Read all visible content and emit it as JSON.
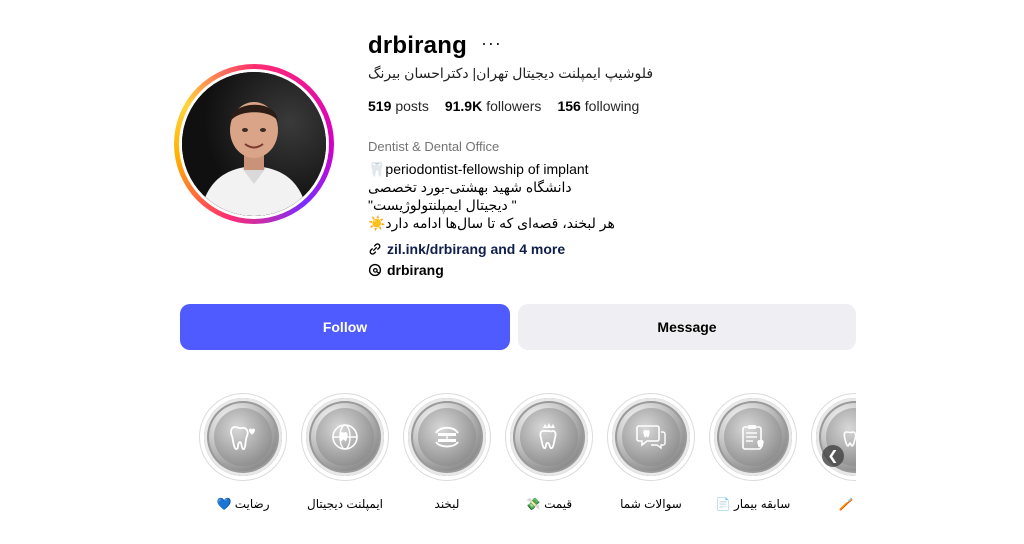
{
  "profile": {
    "username": "drbirang",
    "more_label": "···",
    "full_name": "فلوشیپ ایمپلنت دیجیتال تهران| دکتراحسان بیرنگ",
    "stats": {
      "posts_count": "519",
      "posts_label": "posts",
      "followers_count": "91.9K",
      "followers_label": "followers",
      "following_count": "156",
      "following_label": "following"
    },
    "category": "Dentist & Dental Office",
    "bio": {
      "line1": "🦷periodontist-fellowship of implant",
      "line2": "دانشگاه شهید بهشتی-بورد تخصصی",
      "line3": "\" دیجیتال ایمپلنتولوژیست\"",
      "line4": "هر لبخند، قصه‌ای که تا سال‌ها ادامه دارد☀️"
    },
    "link": "zil.ink/drbirang and 4 more",
    "threads_handle": "drbirang"
  },
  "actions": {
    "follow_label": "Follow",
    "message_label": "Message"
  },
  "highlights": {
    "items": [
      {
        "label": "رضایت 💙",
        "icon": "tooth-heart-icon"
      },
      {
        "label": "ایمپلنت دیجیتال",
        "icon": "globe-tooth-icon"
      },
      {
        "label": "لبخند",
        "icon": "dentures-icon"
      },
      {
        "label": "قیمت 💸",
        "icon": "crown-tooth-icon"
      },
      {
        "label": "سوالات شما",
        "icon": "chat-tooth-icon"
      },
      {
        "label": "سابقه بیمار 📄",
        "icon": "clipboard-tooth-icon"
      },
      {
        "label": "اک 🪥",
        "icon": "toothbrush-icon"
      }
    ],
    "scroll_icon": "chevron-left-icon"
  },
  "colors": {
    "follow_button": "#4f5bff",
    "message_button": "#efeff3",
    "link_text": "#0f1e4a"
  }
}
